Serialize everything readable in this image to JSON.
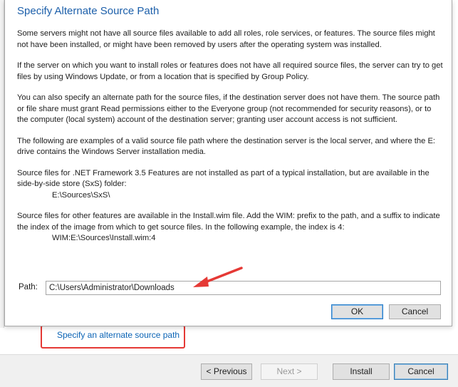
{
  "dialog": {
    "title": "Specify Alternate Source Path",
    "paragraphs": [
      "Some servers might not have all source files available to add all roles, role services, or features. The source files might not have been installed, or might have been removed by users after the operating system was installed.",
      "If the server on which you want to install roles or features does not have all required source files, the server can try to get files by using Windows Update, or from a location that is specified by Group Policy.",
      "You can also specify an alternate path for the source files, if the destination server does not have them. The source path or file share must grant Read permissions either to the Everyone group (not recommended for security reasons), or to the computer (local system) account of the destination server; granting user account access is not sufficient.",
      "The following are examples of a valid source file path where the destination server is the local server, and where the E: drive contains the Windows Server installation media."
    ],
    "sxs_text": "Source files for .NET Framework 3.5 Features are not installed as part of a typical installation, but are available in the side-by-side store (SxS) folder:",
    "sxs_path": "E:\\Sources\\SxS\\",
    "wim_text": "Source files for other features are available in the Install.wim file. Add the WIM: prefix to the path, and a suffix to indicate the index of the image from which to get source files. In the following example, the index is 4:",
    "wim_path": "WIM:E:\\Sources\\Install.wim:4",
    "path_label": "Path:",
    "path_value": "C:\\Users\\Administrator\\Downloads",
    "ok_label": "OK",
    "cancel_label": "Cancel"
  },
  "wizard": {
    "alternate_link": "Specify an alternate source path",
    "previous_label": "< Previous",
    "next_label": "Next >",
    "install_label": "Install",
    "cancel_label": "Cancel"
  },
  "colors": {
    "title": "#1c5faa",
    "link": "#0a63b5",
    "annotation": "#e53935"
  }
}
